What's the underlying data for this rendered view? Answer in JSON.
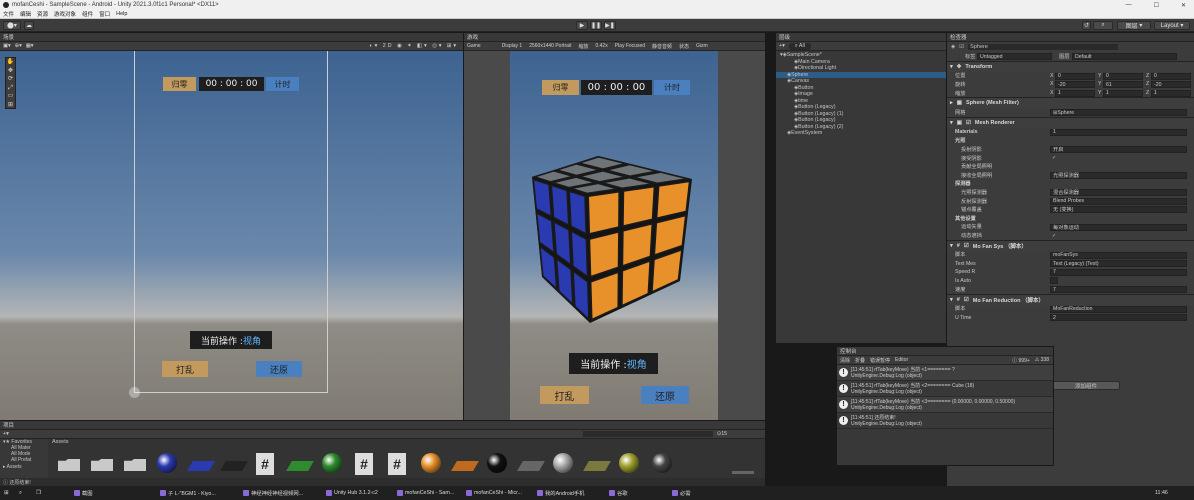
{
  "window": {
    "title": "mofanCeshi - SampleScene - Android - Unity 2021.3.0f1c1 Personal* <DX11>",
    "menus": [
      "文件",
      "编辑",
      "资源",
      "游戏对象",
      "组件",
      "窗口",
      "Help"
    ]
  },
  "toolbar": {
    "layers": "图层",
    "layout": "Layout"
  },
  "scene": {
    "tab": "场景",
    "btn_reset": "归零",
    "btn_timer": "计时",
    "time": "00 : 00 : 00",
    "status_prefix": "当前操作 : ",
    "status_value": "视角",
    "btn_shuffle": "打乱",
    "btn_restore": "还原"
  },
  "game": {
    "tab": "游戏",
    "display_mode": "Game",
    "display": "Display 1",
    "resolution": "2560x1440 Portrait",
    "scale_label": "缩放",
    "scale": "0.42x",
    "play_focused": "Play Focused",
    "mute": "静音音频",
    "stats": "状态",
    "gizmos": "Gizm",
    "btn_reset": "归零",
    "btn_timer": "计时",
    "time": "00 : 00 : 00",
    "status_prefix": "当前操作 : ",
    "status_value": "视角",
    "btn_shuffle": "打乱",
    "btn_restore": "还原"
  },
  "hierarchy": {
    "tab": "层级",
    "search": "All",
    "items": [
      {
        "label": "SampleScene*",
        "depth": 0
      },
      {
        "label": "Main Camera",
        "depth": 2
      },
      {
        "label": "Directional Light",
        "depth": 2
      },
      {
        "label": "Sphere",
        "depth": 1,
        "selected": true
      },
      {
        "label": "Canvas",
        "depth": 1
      },
      {
        "label": "Button",
        "depth": 2
      },
      {
        "label": "Image",
        "depth": 2
      },
      {
        "label": "time",
        "depth": 2
      },
      {
        "label": "Button (Legacy)",
        "depth": 2
      },
      {
        "label": "Button (Legacy) (1)",
        "depth": 2
      },
      {
        "label": "Button (Legacy)",
        "depth": 2
      },
      {
        "label": "Button (Legacy) (2)",
        "depth": 2
      },
      {
        "label": "EventSystem",
        "depth": 1
      }
    ]
  },
  "inspector": {
    "tab": "检查器",
    "object": "Sphere",
    "tag_label": "标签",
    "tag": "Untagged",
    "layer_label": "图层",
    "layer": "Default",
    "transform": {
      "title": "Transform",
      "position_label": "位置",
      "rotation_label": "旋转",
      "scale_label": "缩放",
      "position": [
        "0",
        "0",
        "0"
      ],
      "rotation": [
        "-20",
        "61",
        "-20"
      ],
      "scale": [
        "1",
        "1",
        "1"
      ]
    },
    "mesh_filter": {
      "title": "Sphere (Mesh Filter)",
      "mesh_label": "网格",
      "mesh": "Sphere"
    },
    "mesh_renderer": {
      "title": "Mesh Renderer",
      "materials": "Materials",
      "materials_count": "1",
      "lighting": "光照",
      "cast_shadows": "投射阴影",
      "cast_shadows_value": "开启",
      "receive_shadows": "接受阴影",
      "contribute_gi": "贡献全局照明",
      "receive_gi": "接收全局照明",
      "receive_gi_value": "光照探测器",
      "probes": "探测器",
      "light_probes": "光照探测器",
      "light_probes_value": "混合探测器",
      "reflection_probes": "反射探测器",
      "reflection_probes_value": "Blend Probes",
      "anchor_override": "锚点覆盖",
      "anchor_override_value": "无 (变换)",
      "additional": "其他设置",
      "motion_vectors": "运动矢量",
      "motion_vectors_value": "每对象运动",
      "dynamic_occlusion": "动态遮挡"
    },
    "mofan_sys": {
      "title": "Mo Fan Sys （脚本）",
      "script_label": "脚本",
      "script": "moFanSys",
      "text_mes_label": "Text Mes",
      "text_mes": "Text (Legacy) (Text)",
      "speed_r_label": "Speed R",
      "speed_r": "7",
      "is_auto_label": "Is Auto",
      "speed_label": "速度",
      "speed": "7"
    },
    "mofan_reduction": {
      "title": "Mo Fan Reduction （脚本）",
      "script_label": "脚本",
      "script": "MoFanReduction",
      "u_time_label": "U Time",
      "u_time": "2"
    },
    "add_component": "添加组件"
  },
  "assets": {
    "tab_project": "项目",
    "tab_console": "控制台",
    "favorites": "Favorites",
    "fav_items": [
      "All Mater",
      "All Mode",
      "All Prefat"
    ],
    "assets_label": "Assets",
    "bottom_label": "Assets",
    "count": "15"
  },
  "console": {
    "tab": "控制台",
    "clear": "清除",
    "collapse": "折叠",
    "error_pause": "错误暂停",
    "editor": "Editor",
    "count_log": "999+",
    "count_warn": "338",
    "logs": [
      {
        "line1": "[11:45:51] rfTab(keyMove) 当前 <1======== ?",
        "line2": "UnityEngine.Debug:Log (object)"
      },
      {
        "line1": "[11:45:51] rfTab(keyMove) 当前 <2======== Cube (18)",
        "line2": "UnityEngine.Debug:Log (object)"
      },
      {
        "line1": "[11:45:51] rfTab(keyMove) 当前 <3======== (0.00000, 0.00000, 0.50000)",
        "line2": "UnityEngine.Debug:Log (object)"
      },
      {
        "line1": "[11:45:51] 还原结束!",
        "line2": "UnityEngine.Debug:Log (object)"
      }
    ]
  },
  "statusbar": {
    "text": "还原结束!"
  },
  "taskbar": {
    "items": [
      "截图",
      "子 L-\"BGM1 - Kiyo...",
      "神经神经神经视频网...",
      "Unity Hub 3.1.2-c2",
      "mofanCeShi - Sam...",
      "mofanCeShi - Micr...",
      "我的Android手机",
      "谷歌",
      "必需"
    ],
    "clock": "11:46"
  },
  "colors": {
    "btn": "#c29a5d",
    "btn_blue": "#4a7fc0",
    "time_bg": "#1e1e1e",
    "cube_orange": "#e8902a",
    "cube_blue": "#2a3ab0",
    "cube_gray": "#6f7478"
  }
}
